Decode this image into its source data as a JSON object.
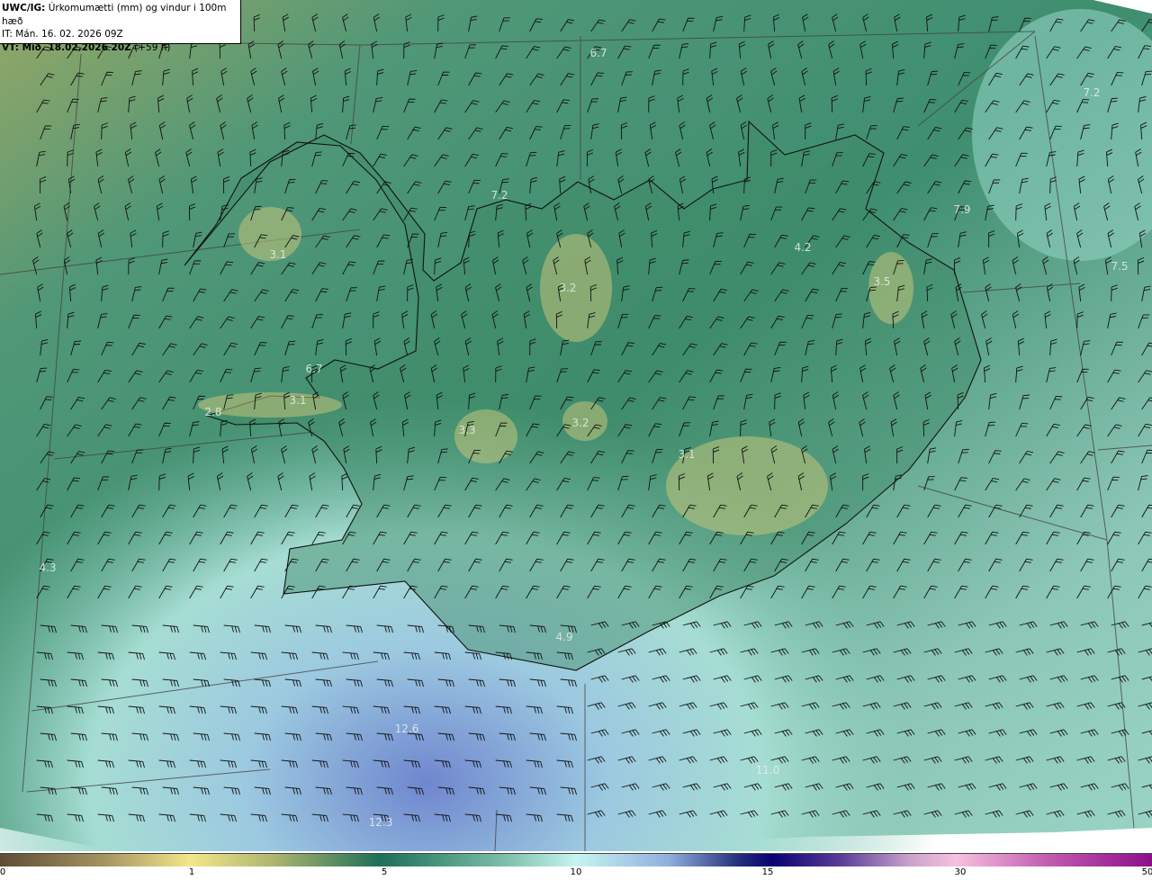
{
  "header": {
    "model": "UWC/IG:",
    "title": "Úrkomumætti (mm) og vindur i 100m hæð",
    "issue_time": "IT: Mán. 16. 02. 2026 09Z",
    "valid_prefix": "VT: Mið. 18.02.2026 20Z",
    "valid_offset": "(+59 h)"
  },
  "map_labels": [
    {
      "text": "6.7"
    },
    {
      "text": "7.2"
    },
    {
      "text": "7.2"
    },
    {
      "text": "7.9"
    },
    {
      "text": "4.2"
    },
    {
      "text": "7.5"
    },
    {
      "text": "3.1"
    },
    {
      "text": "3.2"
    },
    {
      "text": "3.5"
    },
    {
      "text": "6.7"
    },
    {
      "text": "3.1"
    },
    {
      "text": "2.8"
    },
    {
      "text": "3.3"
    },
    {
      "text": "3.2"
    },
    {
      "text": "3.1"
    },
    {
      "text": "4.3"
    },
    {
      "text": "4.9"
    },
    {
      "text": "12.6"
    },
    {
      "text": "11.0"
    },
    {
      "text": "12.3"
    }
  ],
  "colorbar": {
    "ticks": [
      "0",
      "1",
      "5",
      "10",
      "15",
      "30",
      "50"
    ],
    "colors": [
      "#5e4c36",
      "#f4e68a",
      "#1d6f58",
      "#c6f4f1",
      "#0a0070",
      "#f6c1de",
      "#8c0e8a"
    ]
  }
}
